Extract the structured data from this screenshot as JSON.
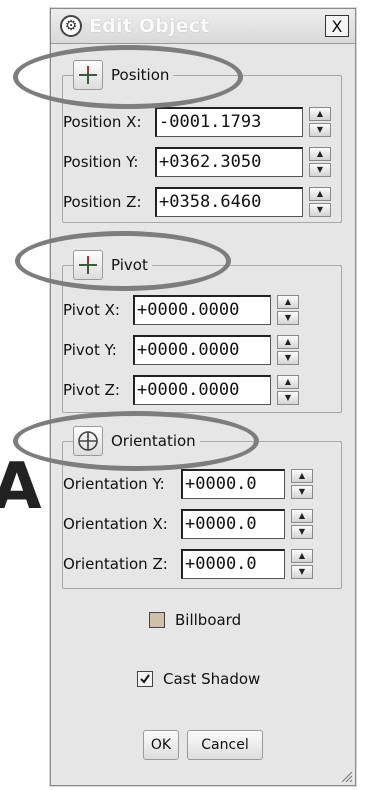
{
  "side_letter": "A",
  "dialog": {
    "title": "Edit Object",
    "close_label": "X"
  },
  "position": {
    "legend": "Position",
    "rows": [
      {
        "label": "Position X:",
        "value": "-0001.1793"
      },
      {
        "label": "Position Y:",
        "value": "+0362.3050"
      },
      {
        "label": "Position Z:",
        "value": "+0358.6460"
      }
    ]
  },
  "pivot": {
    "legend": "Pivot",
    "rows": [
      {
        "label": "Pivot X:",
        "value": "+0000.0000"
      },
      {
        "label": "Pivot Y:",
        "value": "+0000.0000"
      },
      {
        "label": "Pivot Z:",
        "value": "+0000.0000"
      }
    ]
  },
  "orientation": {
    "legend": "Orientation",
    "rows": [
      {
        "label": "Orientation Y:",
        "value": "+0000.0"
      },
      {
        "label": "Orientation X:",
        "value": "+0000.0"
      },
      {
        "label": "Orientation Z:",
        "value": "+0000.0"
      }
    ]
  },
  "options": {
    "billboard_label": "Billboard",
    "billboard_checked": false,
    "cast_shadow_label": "Cast Shadow",
    "cast_shadow_checked": true
  },
  "buttons": {
    "ok": "OK",
    "cancel": "Cancel"
  },
  "colors": {
    "highlight": "#7d7d7d",
    "dialog_bg": "#e6e6e6"
  }
}
